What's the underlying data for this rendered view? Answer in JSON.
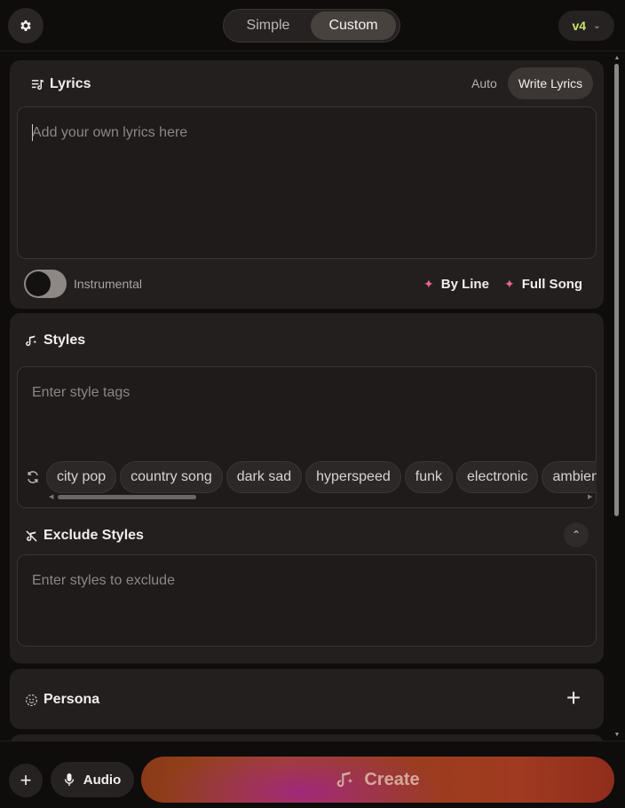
{
  "header": {
    "modes": [
      "Simple",
      "Custom"
    ],
    "active_mode": "Custom",
    "version": "v4"
  },
  "lyrics": {
    "title": "Lyrics",
    "tabs": [
      "Auto",
      "Write Lyrics"
    ],
    "active_tab": "Write Lyrics",
    "placeholder": "Add your own lyrics here",
    "instrumental_label": "Instrumental",
    "instrumental_on": false,
    "by_line_label": "By Line",
    "full_song_label": "Full Song"
  },
  "styles": {
    "title": "Styles",
    "placeholder": "Enter style tags",
    "tags": [
      "city pop",
      "country song",
      "dark sad",
      "hyperspeed",
      "funk",
      "electronic",
      "ambient"
    ]
  },
  "exclude": {
    "title": "Exclude Styles",
    "placeholder": "Enter styles to exclude"
  },
  "persona": {
    "title": "Persona"
  },
  "footer": {
    "audio_label": "Audio",
    "create_label": "Create"
  },
  "colors": {
    "accent_version": "#c7e36b",
    "sparkle": "#f0628e",
    "background": "#0f0c0c",
    "card": "#221f1e"
  }
}
